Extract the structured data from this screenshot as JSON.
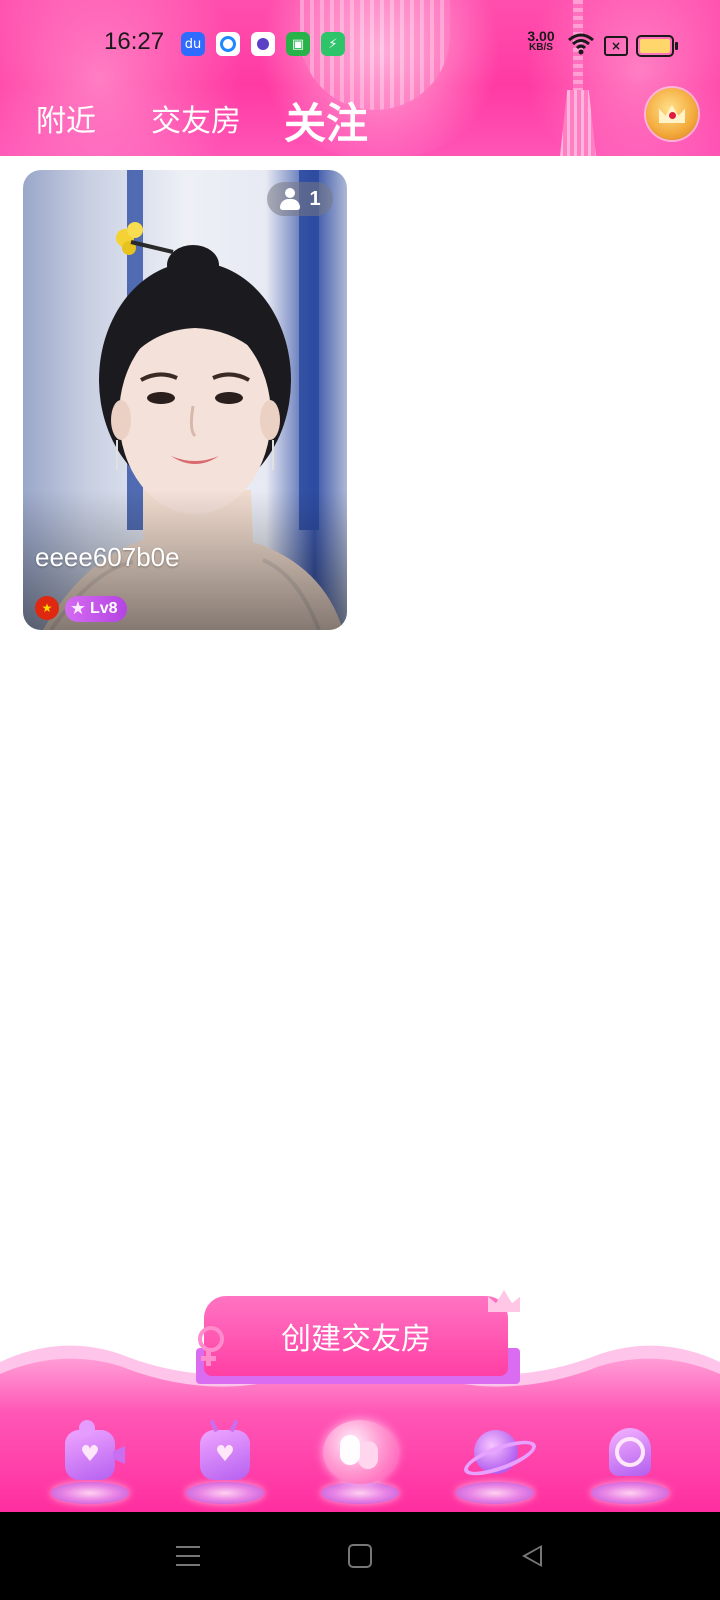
{
  "status_bar": {
    "time": "16:27",
    "net_speed_value": "3.00",
    "net_speed_unit": "KB/S",
    "app_icons": [
      "baidu-icon",
      "browser-icon",
      "app-icon",
      "store-icon",
      "charge-app-icon"
    ]
  },
  "tabs": [
    {
      "label": "附近",
      "active": false
    },
    {
      "label": "交友房",
      "active": false
    },
    {
      "label": "关注",
      "active": true
    }
  ],
  "room_card": {
    "viewer_count": "1",
    "name": "eeee607b0e",
    "level": "Lv8",
    "country_flag": "china-flag-icon"
  },
  "create_room_label": "创建交友房",
  "bottom_nav": [
    {
      "icon": "video-heart-icon"
    },
    {
      "icon": "tv-heart-icon"
    },
    {
      "icon": "friends-room-icon",
      "active": true
    },
    {
      "icon": "planet-icon"
    },
    {
      "icon": "profile-blob-icon"
    }
  ],
  "colors": {
    "accent_pink": "#ff3fa5",
    "accent_purple": "#b560f0",
    "level_badge": "#c25ae8"
  }
}
